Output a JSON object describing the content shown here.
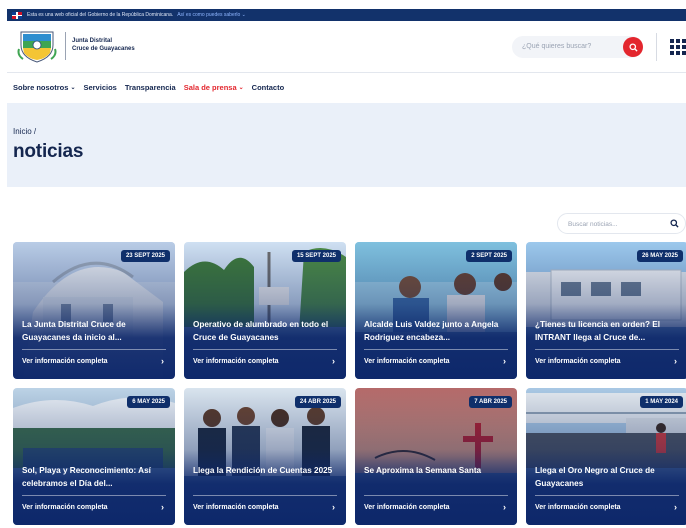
{
  "gov_bar": {
    "text": "Esta es una web oficial del Gobierno de la República Dominicana.",
    "link": "Así es como puedes saberlo ⌄"
  },
  "header": {
    "org_line1": "Junta Distrital",
    "org_line2": "Cruce de Guayacanes",
    "search_placeholder": "¿Qué quieres buscar?"
  },
  "nav": {
    "items": [
      {
        "label": "Sobre nosotros",
        "chevron": "⌄"
      },
      {
        "label": "Servicios"
      },
      {
        "label": "Transparencia"
      },
      {
        "label": "Sala de prensa",
        "chevron": "⌄"
      },
      {
        "label": "Contacto"
      }
    ]
  },
  "hero": {
    "breadcrumb": "Inicio  /",
    "title": "noticias"
  },
  "news_search": {
    "placeholder": "Buscar noticias..."
  },
  "cards": [
    {
      "date": "23 SEPT 2025",
      "title": "La Junta Distrital Cruce de Guayacanes da inicio al...",
      "more": "Ver información completa"
    },
    {
      "date": "15 SEPT 2025",
      "title": "Operativo de alumbrado en todo el Cruce de Guayacanes",
      "more": "Ver información completa"
    },
    {
      "date": "2 SEPT 2025",
      "title": "Alcalde Luis Valdez junto a Angela Rodriguez encabeza...",
      "more": "Ver información completa"
    },
    {
      "date": "26 MAY 2025",
      "title": "¿Tienes tu licencia en orden? El INTRANT llega al Cruce de...",
      "more": "Ver información completa"
    },
    {
      "date": "6 MAY 2025",
      "title": "Sol, Playa y Reconocimiento: Así celebramos el Día del...",
      "more": "Ver información completa"
    },
    {
      "date": "24 ABR 2025",
      "title": "Llega la Rendición de Cuentas 2025",
      "more": "Ver información completa"
    },
    {
      "date": "7 ABR 2025",
      "title": "Se Aproxima la Semana Santa",
      "more": "Ver información completa"
    },
    {
      "date": "1 MAY 2024",
      "title": "Llega el Oro Negro al Cruce de Guayacanes",
      "more": "Ver información completa"
    }
  ],
  "colors": {
    "navy": "#14264f",
    "accent_red": "#e3262e",
    "gov_bar": "#12326b",
    "hero_bg": "#eaf0f9"
  }
}
